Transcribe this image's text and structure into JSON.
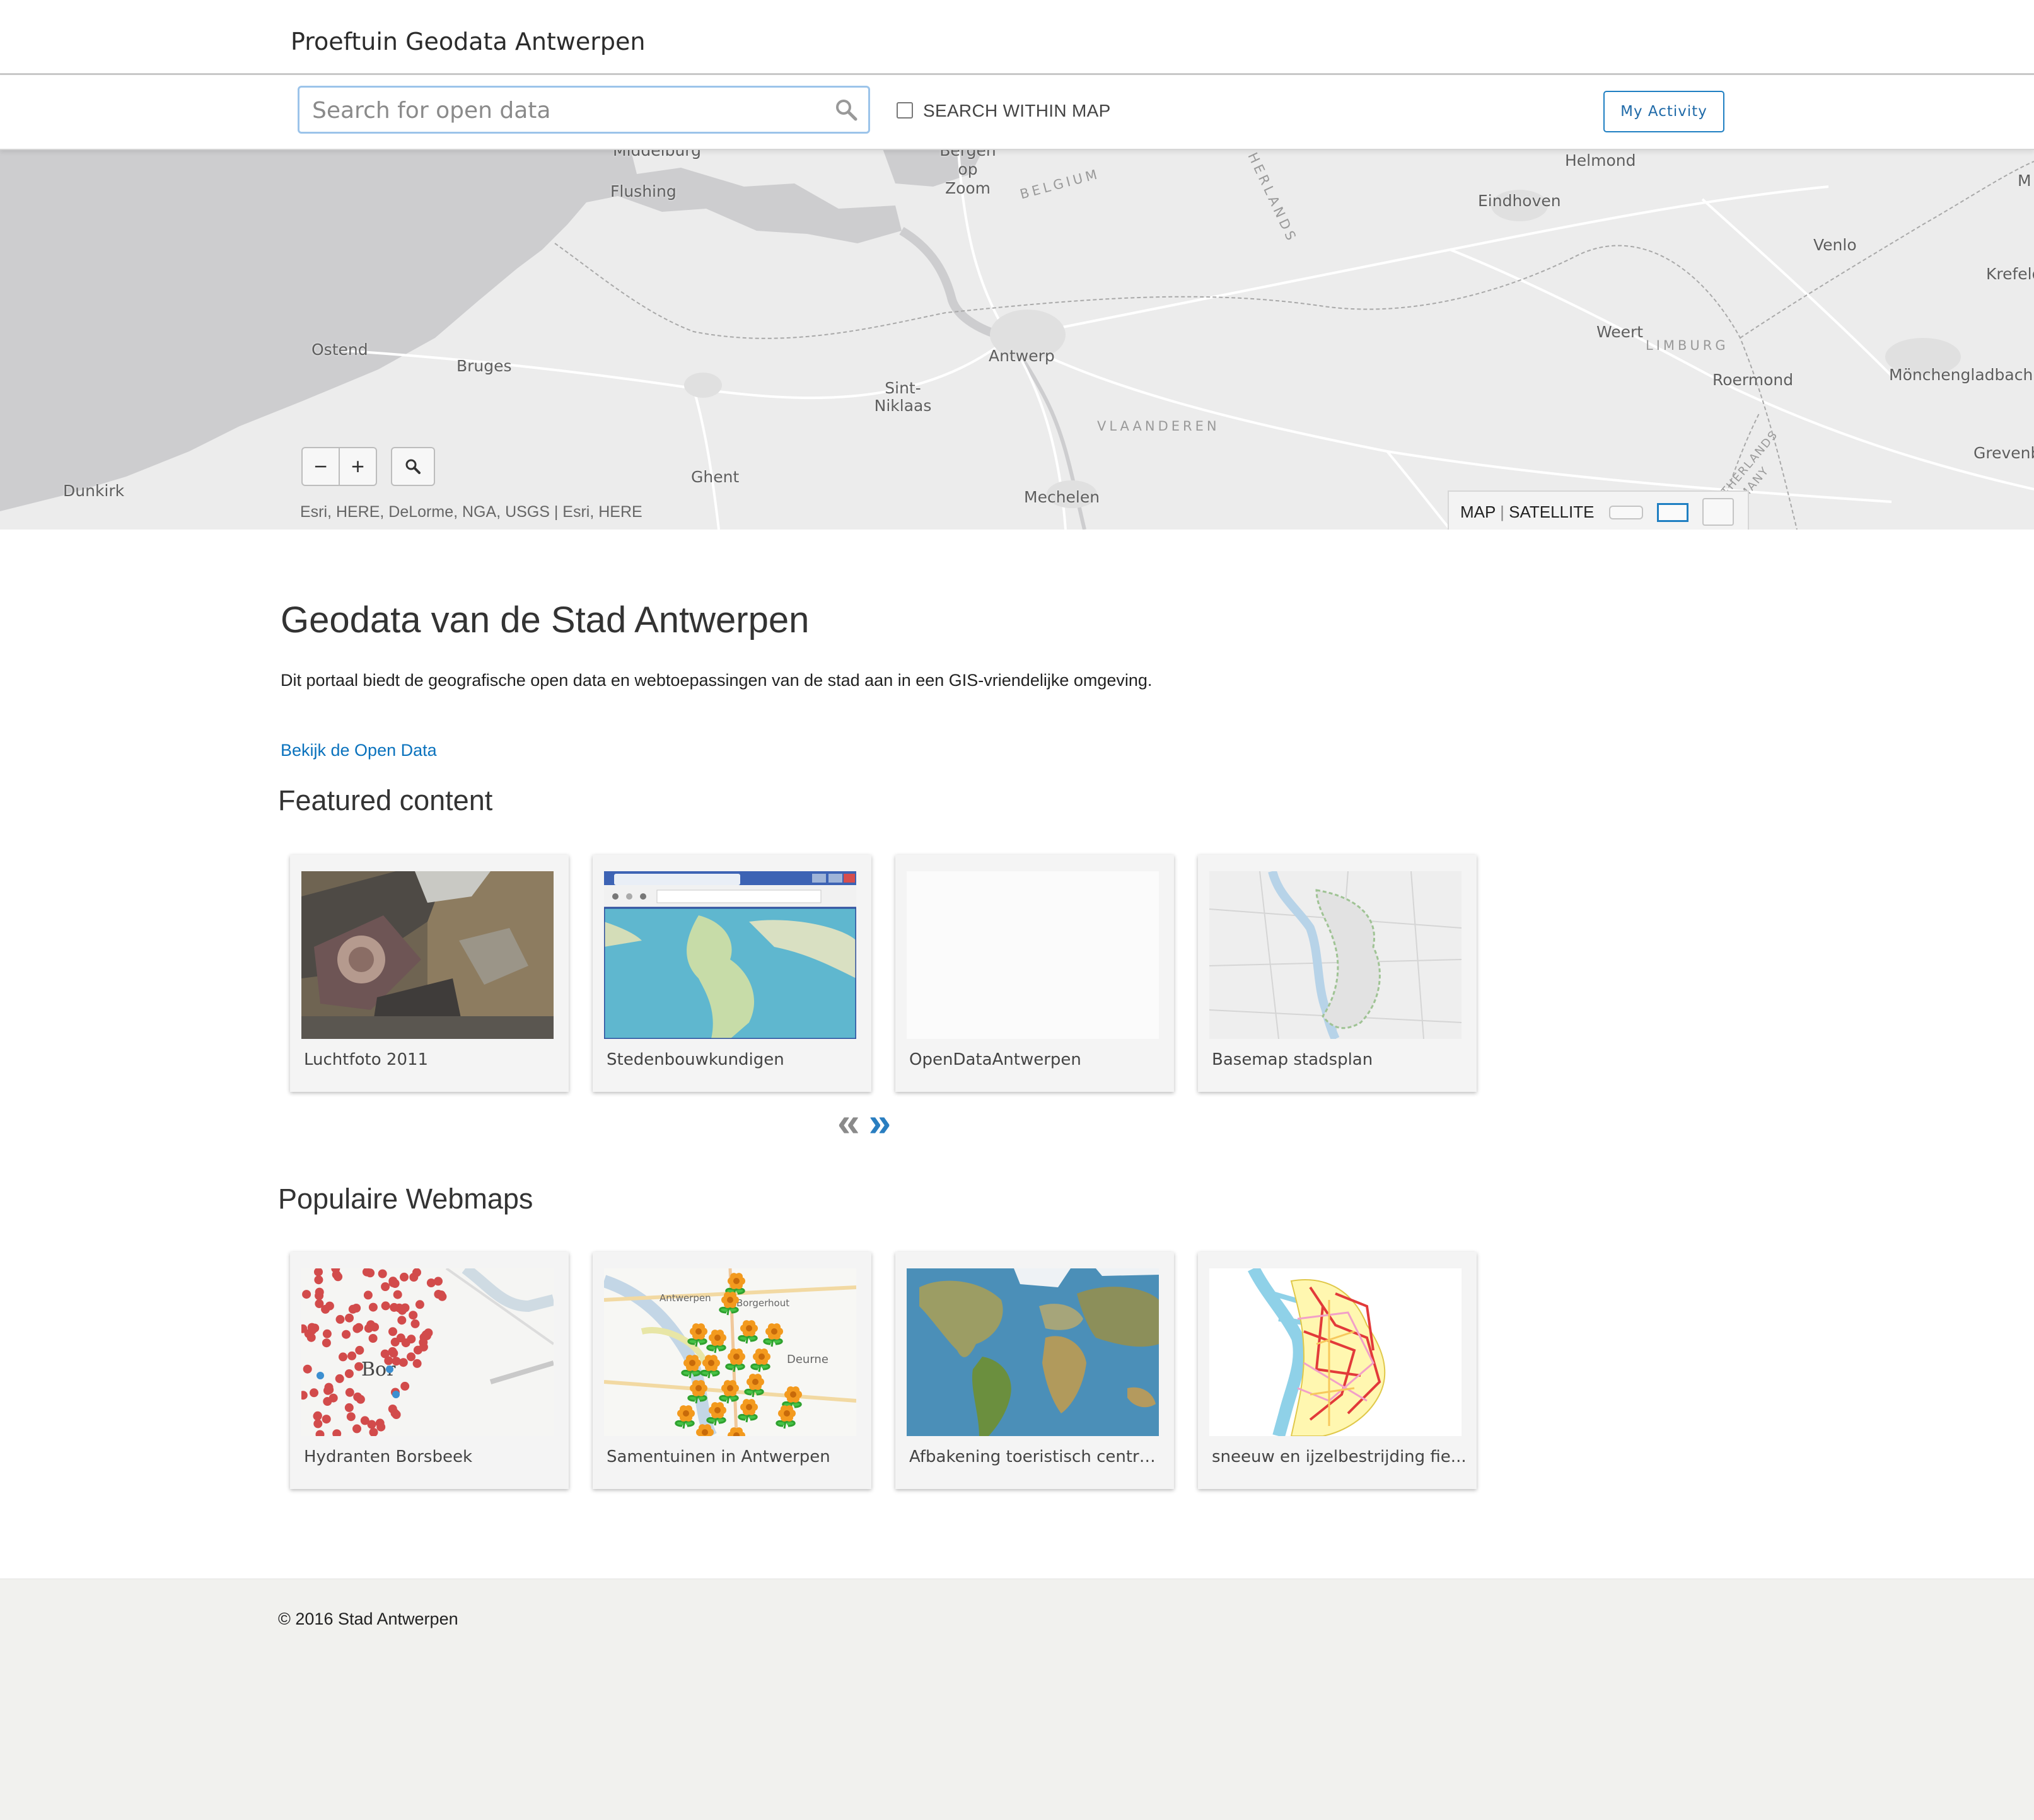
{
  "header": {
    "site_title": "Proeftuin Geodata Antwerpen"
  },
  "search": {
    "placeholder": "Search for open data",
    "within_map_label": "SEARCH WITHIN MAP",
    "within_map_checked": false,
    "my_activity_label": "My Activity",
    "search_icon": "search-icon"
  },
  "map": {
    "places": [
      {
        "name": "Middelburg"
      },
      {
        "name": "Flushing"
      },
      {
        "name": "Bergen op Zoom"
      },
      {
        "name": "Helmond"
      },
      {
        "name": "Eindhoven"
      },
      {
        "name": "Venlo"
      },
      {
        "name": "Krefeld"
      },
      {
        "name": "Ostend"
      },
      {
        "name": "Bruges"
      },
      {
        "name": "Antwerp"
      },
      {
        "name": "Sint-Niklaas"
      },
      {
        "name": "Weert"
      },
      {
        "name": "Roermond"
      },
      {
        "name": "Mönchengladbach"
      },
      {
        "name": "Grevenbroich"
      },
      {
        "name": "Dunkirk"
      },
      {
        "name": "Ghent"
      },
      {
        "name": "Mechelen"
      },
      {
        "name": "M"
      }
    ],
    "regions": [
      "BELGIUM",
      "NETHERLANDS",
      "LIMBURG",
      "VLAANDEREN",
      "NETHERLANDS GERMANY"
    ],
    "zoom_out_label": "−",
    "zoom_in_label": "+",
    "attribution": "Esri, HERE, DeLorme, NGA, USGS |  Esri, HERE",
    "basemap": {
      "map_label": "MAP",
      "separator": "|",
      "satellite_label": "SATELLITE",
      "active_color": "#1f7fc2"
    }
  },
  "intro": {
    "heading": "Geodata van de Stad Antwerpen",
    "description": "Dit portaal biedt de geografische open data en webtoepassingen van de stad aan in een GIS-vriendelijke omgeving.",
    "link_label": "Bekijk de Open Data"
  },
  "featured": {
    "title": "Featured content",
    "items": [
      {
        "label": "Luchtfoto 2011"
      },
      {
        "label": "Stedenbouwkundigen"
      },
      {
        "label": "OpenDataAntwerpen"
      },
      {
        "label": "Basemap stadsplan"
      }
    ],
    "prev_label": "«",
    "next_label": "»",
    "prev_color": "#8a8a8a",
    "next_color": "#2a7ec0"
  },
  "webmaps": {
    "title": "Populaire Webmaps",
    "items": [
      {
        "label": "Hydranten Borsbeek"
      },
      {
        "label": "Samentuinen in Antwerpen"
      },
      {
        "label": "Afbakening toeristisch centru..."
      },
      {
        "label": "sneeuw en ijzelbestrijding fie..."
      }
    ],
    "thumb_texts": {
      "bor": "Bor",
      "antwerpen": "Antwerpen",
      "deurne": "Deurne",
      "borgerhout": "Borgerhout"
    }
  },
  "footer": {
    "copyright": "© 2016 Stad Antwerpen"
  }
}
